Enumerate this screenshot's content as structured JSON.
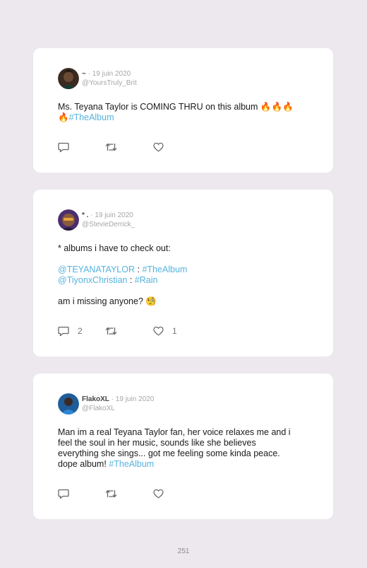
{
  "tweets": [
    {
      "display_name": "~",
      "date": "· 19 juin 2020",
      "handle": "@YoursTruly_Brit",
      "text": "Ms. Teyana Taylor is COMING THRU on this album",
      "emoji": "🔥🔥🔥",
      "emoji2": "🔥",
      "hashtag": "#TheAlbum",
      "reply_count": "",
      "like_count": ""
    },
    {
      "display_name": "* .",
      "date": "· 19 juin 2020",
      "handle": "@StevieDerrick_",
      "line1": "* albums i have to check out:",
      "mention1": "@TEYANATAYLOR",
      "sep1": " : ",
      "tag1": "#TheAlbum",
      "mention2": "@TiyonxChristian",
      "sep2": " : ",
      "tag2": "#Rain",
      "line_last": "am i missing anyone?",
      "emoji": "🧐",
      "reply_count": "2",
      "like_count": "1"
    },
    {
      "display_name": "FlakoXL",
      "date": "· 19 juin 2020",
      "handle": "@FlakoXL",
      "l1": "Man im a real Teyana Taylor fan, her voice relaxes me and i",
      "l2": "feel the soul in her music, sounds like she believes",
      "l3": "everything she sings... got me feeling some kinda peace.",
      "l4": "dope album!",
      "hashtag": "#TheAlbum",
      "reply_count": "",
      "like_count": ""
    }
  ],
  "page_number": "251",
  "colors": {
    "link": "#55b3de",
    "background": "#ece8ee",
    "card": "#ffffff"
  },
  "icons": [
    "reply-icon",
    "retweet-icon",
    "like-icon"
  ]
}
